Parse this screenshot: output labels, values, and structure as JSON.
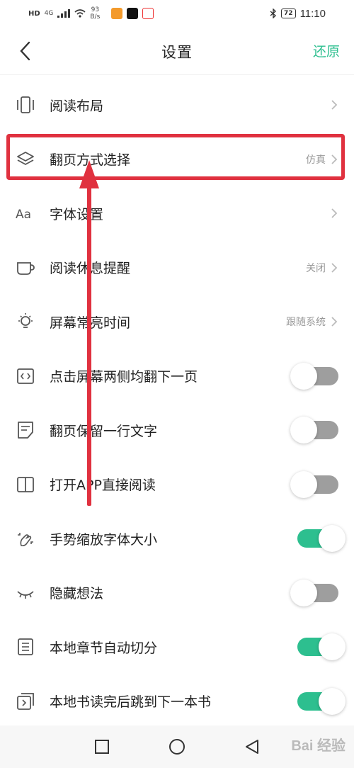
{
  "status_bar": {
    "network": "HD",
    "signal": "4G",
    "speed_value": "93",
    "speed_unit": "B/s",
    "battery": "72",
    "time": "11:10"
  },
  "header": {
    "title": "设置",
    "restore_label": "还原"
  },
  "settings": [
    {
      "label": "阅读布局",
      "icon": "layout-icon",
      "value": "",
      "control": "chevron"
    },
    {
      "label": "翻页方式选择",
      "icon": "layers-icon",
      "value": "仿真",
      "control": "chevron"
    },
    {
      "label": "字体设置",
      "icon": "font-icon",
      "value": "",
      "control": "chevron"
    },
    {
      "label": "阅读休息提醒",
      "icon": "cup-icon",
      "value": "关闭",
      "control": "chevron"
    },
    {
      "label": "屏幕常亮时间",
      "icon": "bulb-icon",
      "value": "跟随系统",
      "control": "chevron"
    },
    {
      "label": "点击屏幕两侧均翻下一页",
      "icon": "code-icon",
      "value": "",
      "control": "toggle",
      "on": false
    },
    {
      "label": "翻页保留一行文字",
      "icon": "note-icon",
      "value": "",
      "control": "toggle",
      "on": false
    },
    {
      "label": "打开APP直接阅读",
      "icon": "book-icon",
      "value": "",
      "control": "toggle",
      "on": false
    },
    {
      "label": "手势缩放字体大小",
      "icon": "gesture-icon",
      "value": "",
      "control": "toggle",
      "on": true
    },
    {
      "label": "隐藏想法",
      "icon": "eye-closed-icon",
      "value": "",
      "control": "toggle",
      "on": false
    },
    {
      "label": "本地章节自动切分",
      "icon": "list-icon",
      "value": "",
      "control": "toggle",
      "on": true
    },
    {
      "label": "本地书读完后跳到下一本书",
      "icon": "next-book-icon",
      "value": "",
      "control": "toggle",
      "on": true
    }
  ],
  "colors": {
    "accent": "#2dbf8f",
    "toggle_off": "#9e9e9e",
    "annotation": "#e0313f"
  },
  "watermark": "Bai 经验"
}
